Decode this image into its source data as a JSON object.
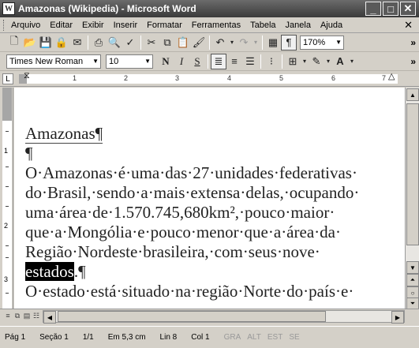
{
  "window": {
    "title": "Amazonas (Wikipedia) - Microsoft Word"
  },
  "menu": [
    "Arquivo",
    "Editar",
    "Exibir",
    "Inserir",
    "Formatar",
    "Ferramentas",
    "Tabela",
    "Janela",
    "Ajuda"
  ],
  "toolbar": {
    "zoom": "170%",
    "font": "Times New Roman",
    "size": "10"
  },
  "ruler": {
    "numbers": [
      "1",
      "2",
      "3",
      "4",
      "5",
      "6",
      "7"
    ]
  },
  "vruler": {
    "numbers": [
      "1",
      "2",
      "3"
    ]
  },
  "document": {
    "lines": [
      "Amazonas¶",
      "¶",
      "O·Amazonas·é·uma·das·27·unidades·federativas·",
      "do·Brasil,·sendo·a·mais·extensa·delas,·ocupando·",
      "uma·área·de·1.570.745,680km²,·pouco·maior·",
      "que·a·Mongólia·e·pouco·menor·que·a·área·da·",
      "Região·Nordeste·brasileira,·com·seus·nove·",
      "O·estado·está·situado·na·região·Norte·do·país·e·"
    ],
    "selected_word": "estados",
    "after_selection": ".¶"
  },
  "status": {
    "page": "Pág 1",
    "section": "Seção 1",
    "pages": "1/1",
    "position": "Em 5,3 cm",
    "line": "Lin 8",
    "col": "Col 1",
    "modes": [
      "GRA",
      "ALT",
      "EST",
      "SE"
    ]
  }
}
